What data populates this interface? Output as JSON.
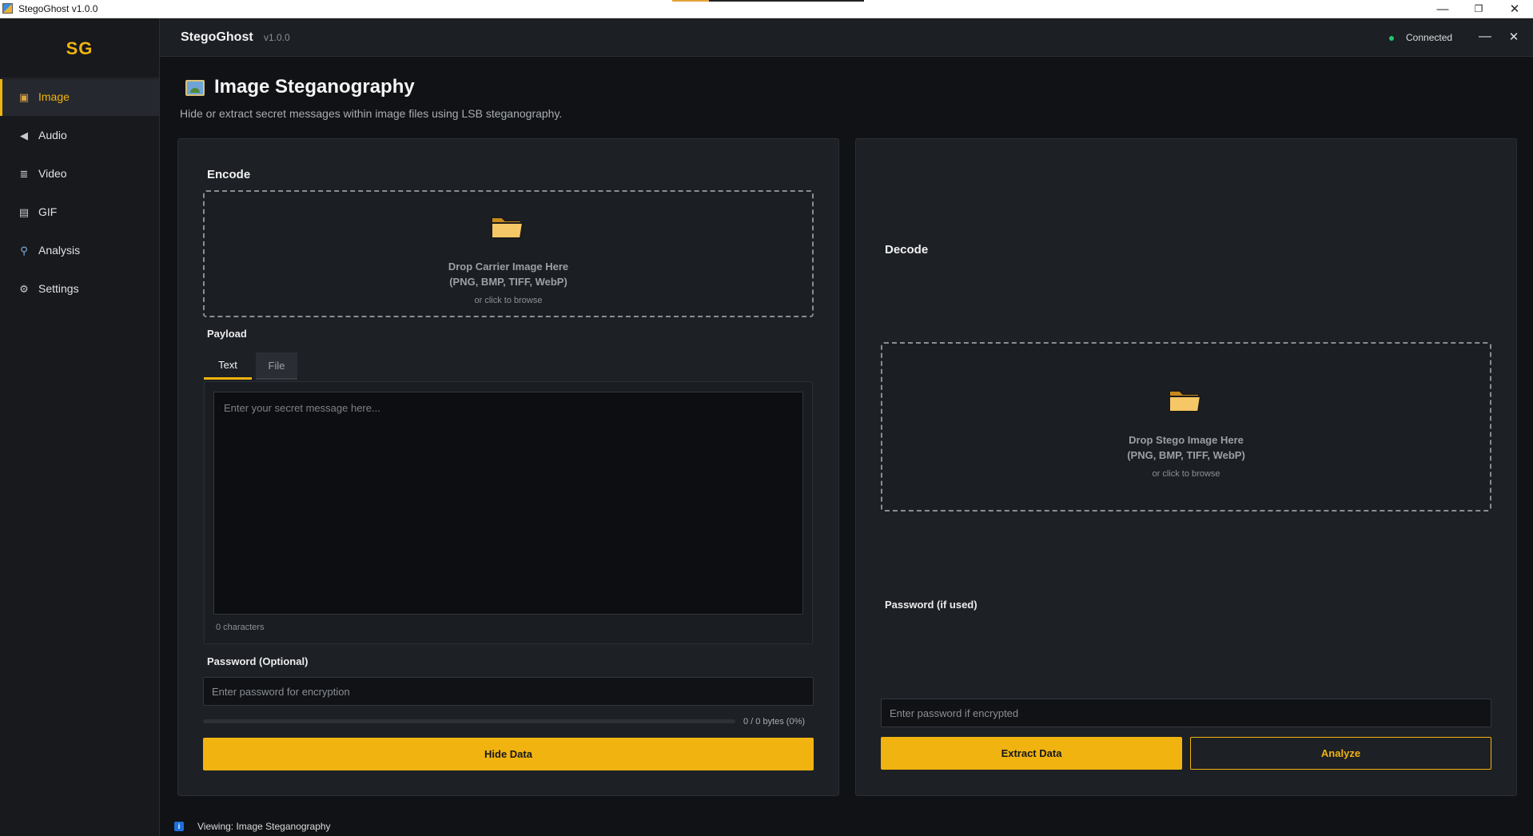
{
  "window": {
    "title": "StegoGhost v1.0.0",
    "controls": {
      "minimize": "—",
      "maximize": "❐",
      "close": "✕"
    }
  },
  "sidebar": {
    "logo": "SG",
    "items": [
      {
        "label": "Image",
        "icon": "image-icon",
        "glyph": "▣",
        "active": true
      },
      {
        "label": "Audio",
        "icon": "speaker-icon",
        "glyph": "◀",
        "active": false
      },
      {
        "label": "Video",
        "icon": "film-icon",
        "glyph": "≣",
        "active": false
      },
      {
        "label": "GIF",
        "icon": "gif-icon",
        "glyph": "▤",
        "active": false
      },
      {
        "label": "Analysis",
        "icon": "magnifier-icon",
        "glyph": "⚲",
        "active": false
      },
      {
        "label": "Settings",
        "icon": "gear-icon",
        "glyph": "⚙",
        "active": false
      }
    ]
  },
  "header": {
    "title": "StegoGhost",
    "version": "v1.0.0",
    "status": "Connected",
    "status_color": "#27c46a",
    "minimize_glyph": "—",
    "close_glyph": "✕"
  },
  "page": {
    "title": "Image Steganography",
    "subtitle": "Hide or extract secret messages within image files using LSB steganography."
  },
  "encode": {
    "title": "Encode",
    "drop": {
      "title_line1": "Drop Carrier Image Here",
      "title_line2": "(PNG, BMP, TIFF, WebP)",
      "hint": "or click to browse"
    },
    "payload_label": "Payload",
    "tabs": [
      {
        "label": "Text",
        "active": true
      },
      {
        "label": "File",
        "active": false
      }
    ],
    "message_placeholder": "Enter your secret message here...",
    "message_value": "",
    "char_count": "0 characters",
    "password_label": "Password (Optional)",
    "password_placeholder": "Enter password for encryption",
    "capacity": {
      "label": "0 / 0 bytes (0%)",
      "percent": 0
    },
    "hide_button": "Hide Data"
  },
  "decode": {
    "title": "Decode",
    "drop": {
      "title_line1": "Drop Stego Image Here",
      "title_line2": "(PNG, BMP, TIFF, WebP)",
      "hint": "or click to browse"
    },
    "password_label": "Password (if used)",
    "password_placeholder": "Enter password if encrypted",
    "extract_button": "Extract Data",
    "analyze_button": "Analyze"
  },
  "footer": {
    "status": "Viewing: Image Steganography",
    "icon_glyph": "i"
  },
  "colors": {
    "accent": "#f0b310",
    "background": "#101215",
    "panel": "#1d2025",
    "sidebar": "#17191d"
  }
}
